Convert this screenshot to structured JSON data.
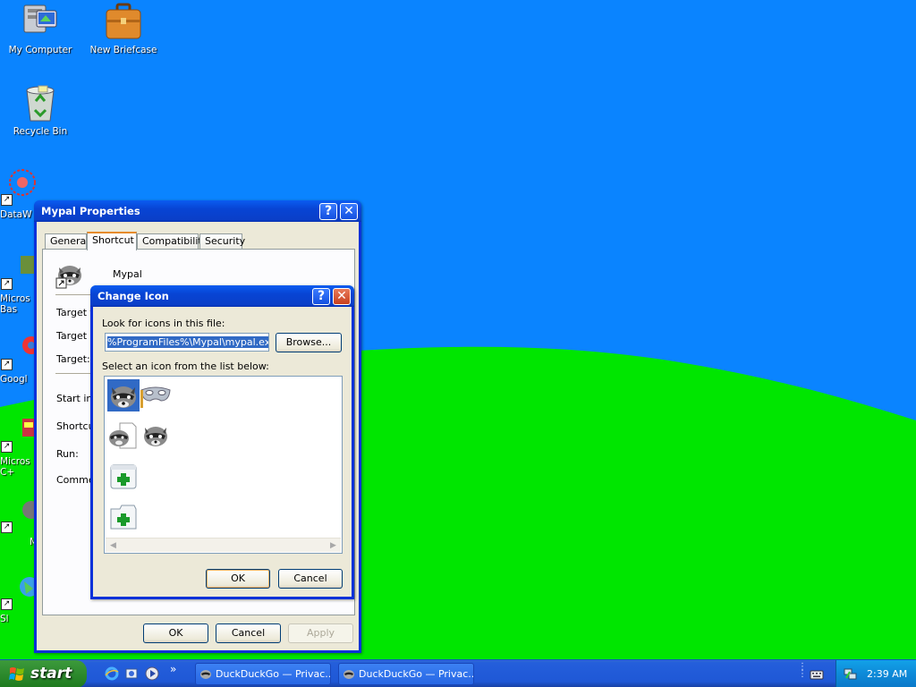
{
  "desktop": {
    "icons": [
      {
        "label": "My Computer",
        "icon": "computer-icon"
      },
      {
        "label": "New Briefcase",
        "icon": "briefcase-icon"
      },
      {
        "label": "Recycle Bin",
        "icon": "recycle-bin-icon"
      },
      {
        "label": "DataW",
        "icon": "datawatch-icon"
      },
      {
        "label": "Micros\nBas",
        "icon": "app-icon"
      },
      {
        "label": "Googl",
        "icon": "chrome-icon"
      },
      {
        "label": "Micros\nC+",
        "icon": "app-icon"
      },
      {
        "label": "M",
        "icon": "raccoon-icon"
      },
      {
        "label": "Sl",
        "icon": "globe-icon"
      }
    ]
  },
  "properties_window": {
    "title": "Mypal Properties",
    "tabs": [
      "General",
      "Shortcut",
      "Compatibility",
      "Security"
    ],
    "active_tab": "Shortcut",
    "app_name": "Mypal",
    "fields": [
      "Target t",
      "Target l",
      "Target:",
      "Start in:",
      "Shortcu",
      "Run:",
      "Commer"
    ],
    "buttons": {
      "ok": "OK",
      "cancel": "Cancel",
      "apply": "Apply"
    }
  },
  "change_icon_dialog": {
    "title": "Change Icon",
    "look_label": "Look for icons in this file:",
    "file_path": "%ProgramFiles%\\Mypal\\mypal.exe",
    "browse_label": "Browse...",
    "select_label": "Select an icon from the list below:",
    "icons": [
      "raccoon-icon",
      "mask-icon",
      "raccoon-document-icon",
      "raccoon-icon",
      "add-window-icon",
      "add-document-icon"
    ],
    "selected_index": 0,
    "buttons": {
      "ok": "OK",
      "cancel": "Cancel"
    }
  },
  "taskbar": {
    "start_label": "start",
    "quick_launch": [
      "ie-icon",
      "outlook-icon",
      "media-player-icon"
    ],
    "more": "»",
    "tasks": [
      {
        "label": "DuckDuckGo — Privac...",
        "icon": "raccoon-icon"
      },
      {
        "label": "DuckDuckGo — Privac...",
        "icon": "raccoon-icon"
      }
    ],
    "time": "2:39 AM"
  },
  "colors": {
    "sky": "#0a84ff",
    "grass": "#00e600",
    "title_blue": "#0a4fe0",
    "task_blue": "#2766e4",
    "start_green": "#2d8a2d",
    "selection": "#316ac5"
  }
}
